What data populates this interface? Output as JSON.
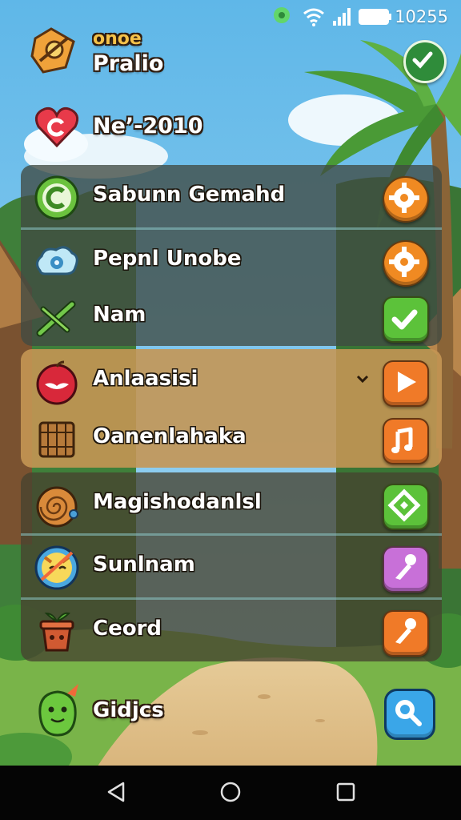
{
  "status_bar": {
    "time": "10255"
  },
  "header": {
    "title": "onoe",
    "subtitle": "Pralio",
    "lives_text": "Ne’-2010"
  },
  "menu": {
    "items": [
      {
        "label": "Sabunn Gemahd",
        "icon": "green-c-badge-icon",
        "action": "gear-button-icon",
        "action_color": "#f08a22"
      },
      {
        "label": "Pepnl Unobe",
        "icon": "cloud-camera-icon",
        "action": "gear-button-icon",
        "action_color": "#f08a22"
      },
      {
        "label": "Nam",
        "icon": "green-wand-icon",
        "action": "check-button-icon",
        "action_color": "#5cc23a"
      },
      {
        "label": "Anlaasisi",
        "icon": "apple-icon",
        "action": "play-button-icon",
        "action_color": "#f07a28",
        "dropdown": "chevron-down-icon"
      },
      {
        "label": "Oanenlahaka",
        "icon": "wooden-crate-icon",
        "action": "music-note-button-icon",
        "action_color": "#f07a28"
      },
      {
        "label": "Magishodanlsl",
        "icon": "wood-spiral-icon",
        "action": "green-diamond-button-icon",
        "action_color": "#5cc23a"
      },
      {
        "label": "Sunlnam",
        "icon": "fox-badge-icon",
        "action": "pin-button-icon",
        "action_color": "#c870d8"
      },
      {
        "label": "Ceord",
        "icon": "flowerpot-icon",
        "action": "pin-button-icon",
        "action_color": "#f07a28"
      }
    ]
  },
  "footer": {
    "label": "Gidjcs"
  }
}
